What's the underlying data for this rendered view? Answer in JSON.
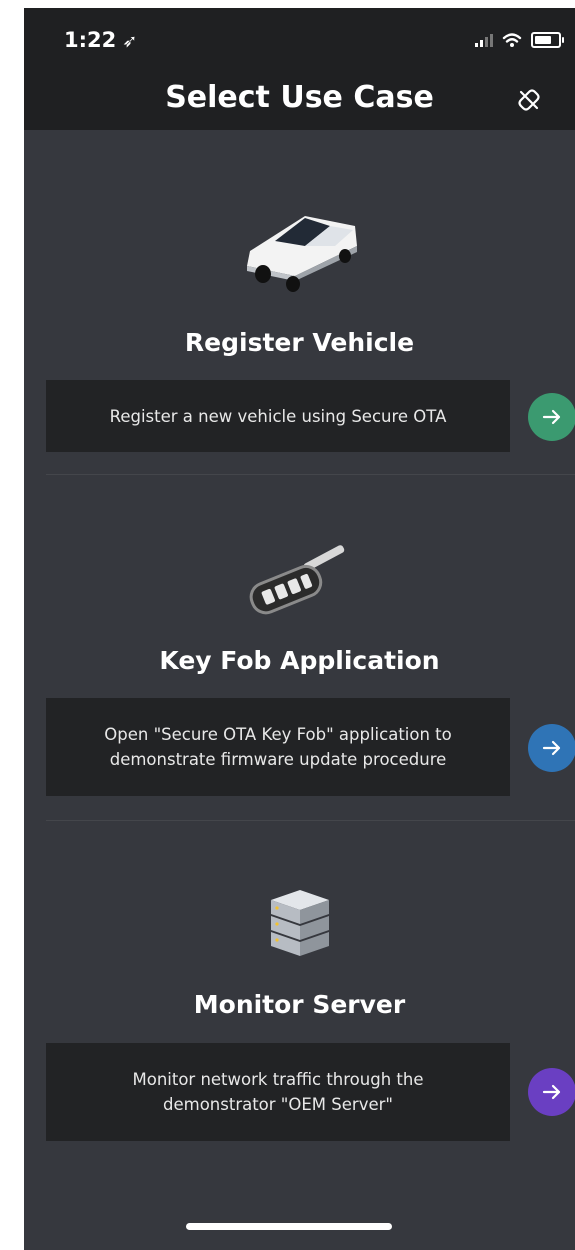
{
  "status_bar": {
    "time": "1:22"
  },
  "header": {
    "title": "Select Use Case"
  },
  "sections": [
    {
      "title": "Register Vehicle",
      "description": "Register a new vehicle using Secure OTA",
      "icon": "vehicle-icon",
      "arrow_color": "#3b9a70"
    },
    {
      "title": "Key Fob Application",
      "description": "Open \"Secure OTA Key Fob\" application to demonstrate firmware update procedure",
      "icon": "key-fob-icon",
      "arrow_color": "#2f74b6"
    },
    {
      "title": "Monitor Server",
      "description": "Monitor network traffic through the demonstrator \"OEM Server\"",
      "icon": "server-icon",
      "arrow_color": "#6a3fc2"
    }
  ],
  "colors": {
    "background": "#36383e",
    "header": "#1f2022",
    "description_box": "#222325"
  }
}
